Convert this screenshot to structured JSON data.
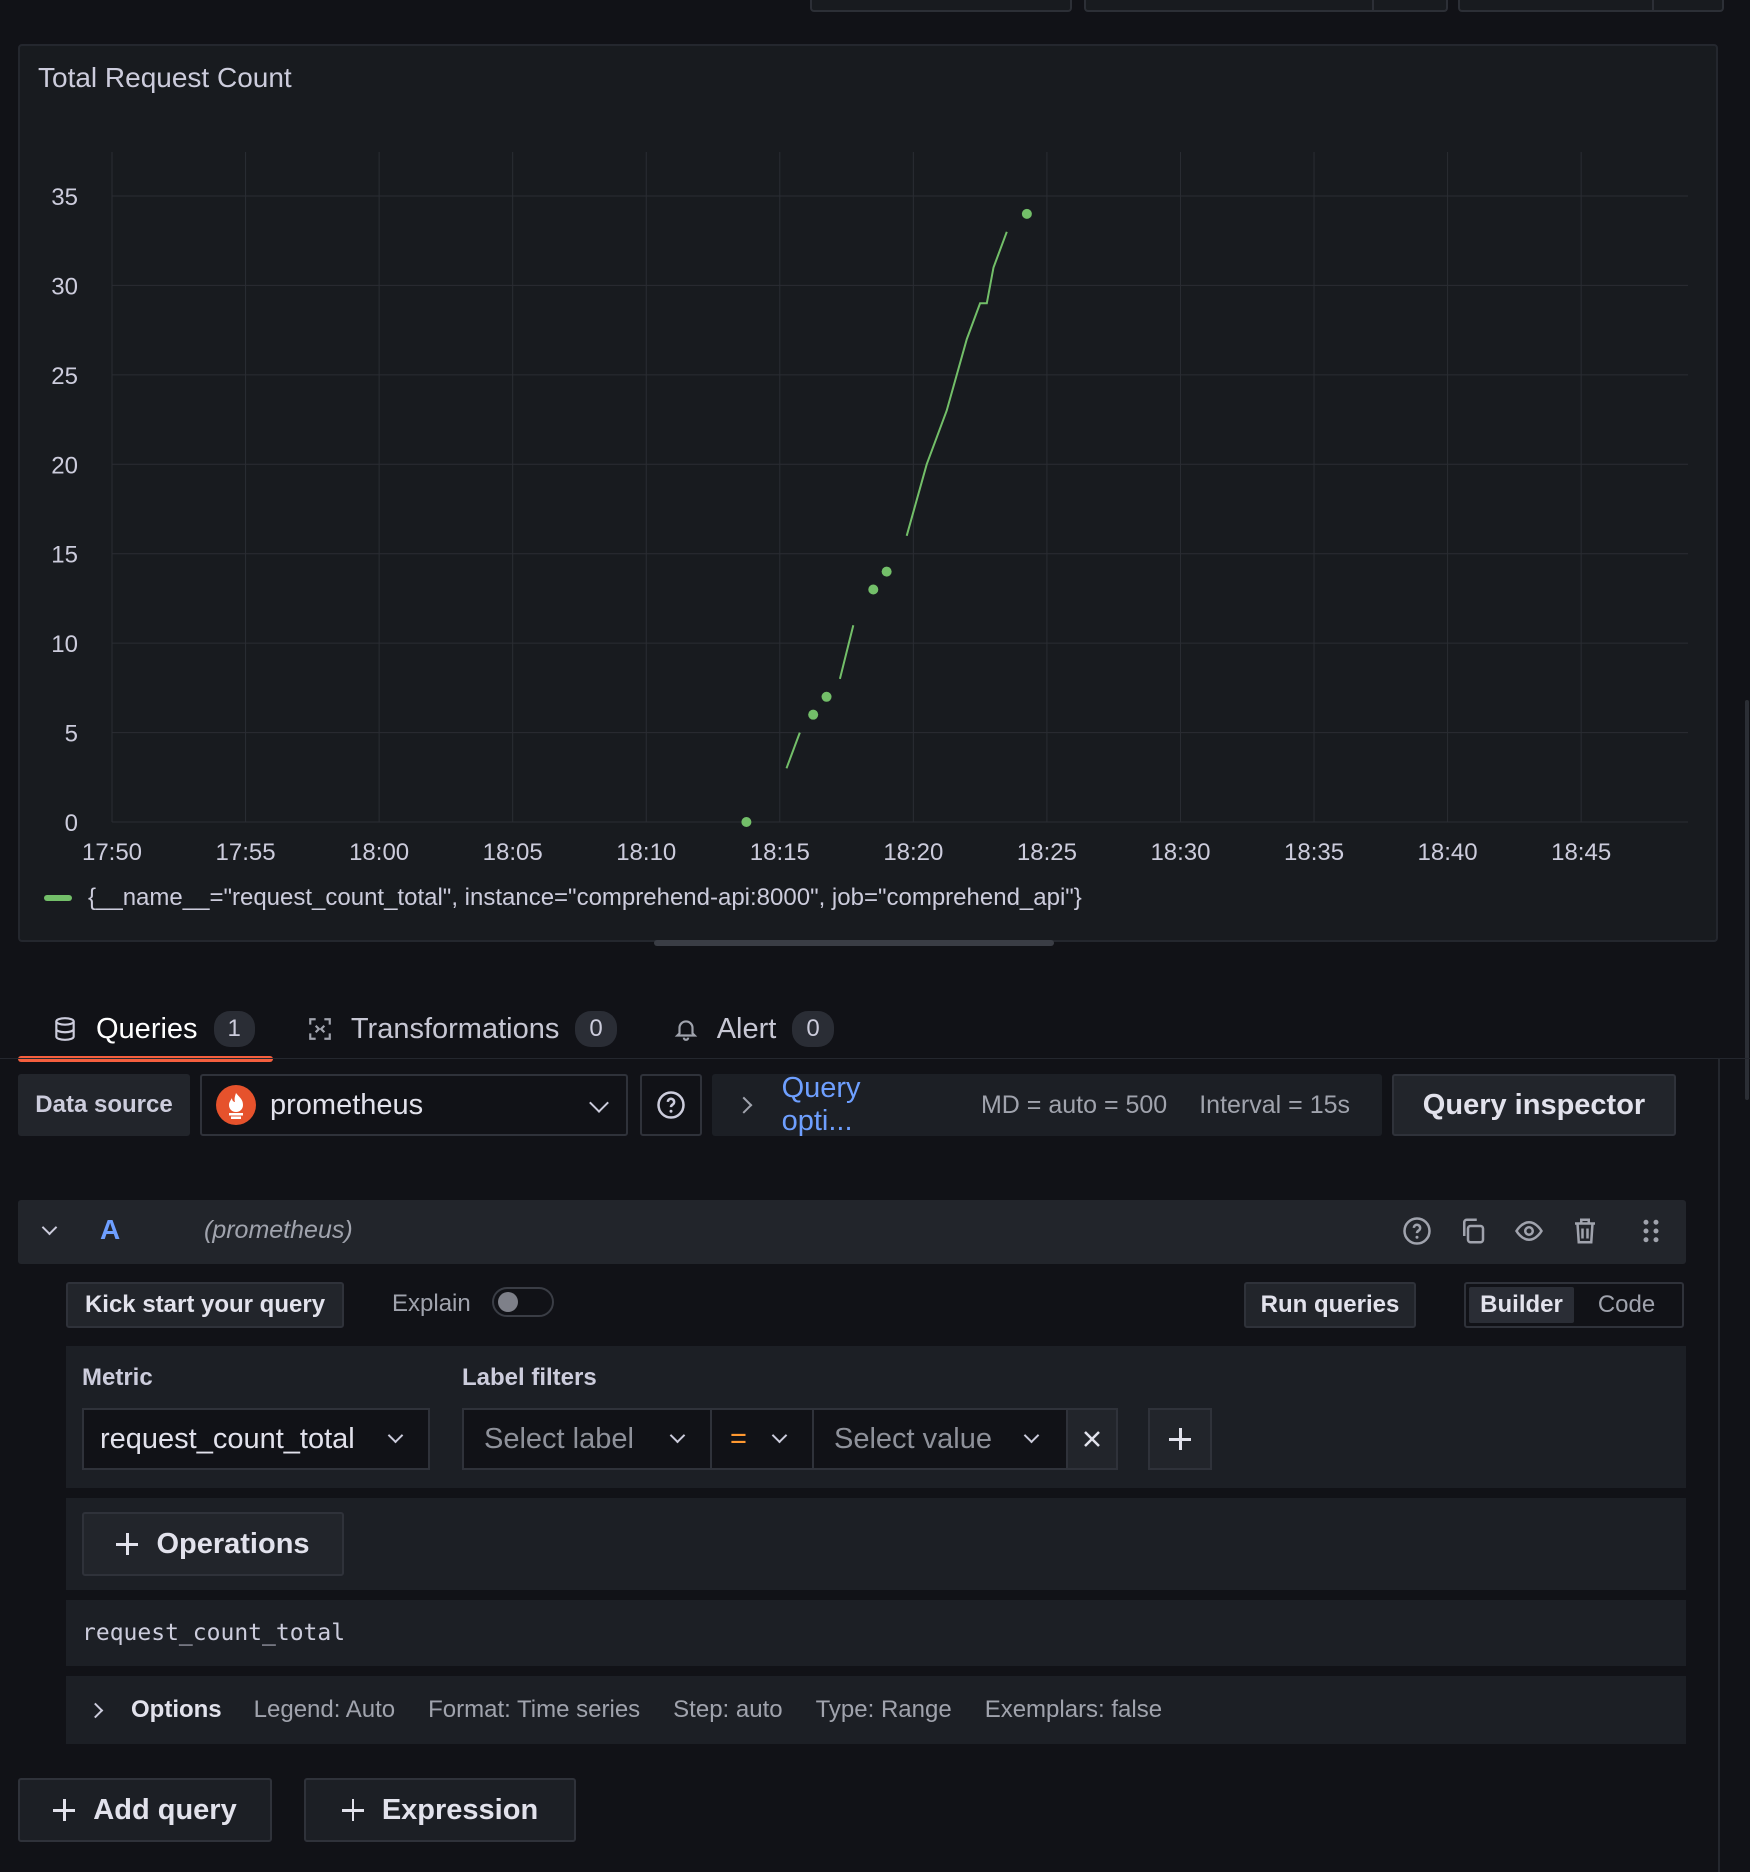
{
  "panel": {
    "title": "Total Request Count",
    "legend_label": "{__name__=\"request_count_total\", instance=\"comprehend-api:8000\", job=\"comprehend_api\"}",
    "series_color": "#73bf69"
  },
  "chart_data": {
    "type": "line",
    "title": "Total Request Count",
    "xlabel": "",
    "ylabel": "",
    "ylim": [
      0,
      35
    ],
    "xlim": [
      "17:50",
      "18:49"
    ],
    "y_ticks": [
      "0",
      "5",
      "10",
      "15",
      "20",
      "25",
      "30",
      "35"
    ],
    "x_ticks": [
      "17:50",
      "17:55",
      "18:00",
      "18:05",
      "18:10",
      "18:15",
      "18:20",
      "18:25",
      "18:30",
      "18:35",
      "18:40",
      "18:45"
    ],
    "grid": true,
    "legend_position": "bottom-left",
    "series": [
      {
        "name": "{__name__=\"request_count_total\", instance=\"comprehend-api:8000\", job=\"comprehend_api\"}",
        "color": "#73bf69",
        "segments": [
          [
            [
              "18:13:45",
              0
            ]
          ],
          [
            [
              "18:15:15",
              3
            ],
            [
              "18:15:45",
              5
            ]
          ],
          [
            [
              "18:16:15",
              6
            ]
          ],
          [
            [
              "18:16:45",
              7
            ]
          ],
          [
            [
              "18:17:15",
              8
            ],
            [
              "18:17:45",
              11
            ]
          ],
          [
            [
              "18:18:30",
              13
            ]
          ],
          [
            [
              "18:19:00",
              14
            ]
          ],
          [
            [
              "18:19:45",
              16
            ],
            [
              "18:20:30",
              20
            ],
            [
              "18:21:15",
              23
            ],
            [
              "18:22:00",
              27
            ],
            [
              "18:22:30",
              29
            ],
            [
              "18:22:45",
              29
            ],
            [
              "18:23:00",
              31
            ],
            [
              "18:23:30",
              33
            ]
          ],
          [
            [
              "18:24:15",
              34
            ]
          ]
        ]
      }
    ]
  },
  "tabs": [
    {
      "label": "Queries",
      "count": "1"
    },
    {
      "label": "Transformations",
      "count": "0"
    },
    {
      "label": "Alert",
      "count": "0"
    }
  ],
  "datasource": {
    "label": "Data source",
    "value": "prometheus",
    "query_options_link": "Query opti...",
    "md": "MD = auto = 500",
    "interval": "Interval = 15s",
    "inspector": "Query inspector"
  },
  "query": {
    "ref": "A",
    "datasource": "(prometheus)",
    "kickstart": "Kick start your query",
    "explain": "Explain",
    "run": "Run queries",
    "mode_builder": "Builder",
    "mode_code": "Code",
    "metric_label": "Metric",
    "metric_value": "request_count_total",
    "label_filters": "Label filters",
    "select_label": "Select label",
    "operator": "=",
    "select_value": "Select value",
    "operations": "Operations",
    "promql": "request_count_total",
    "options_title": "Options",
    "options": [
      "Legend: Auto",
      "Format: Time series",
      "Step: auto",
      "Type: Range",
      "Exemplars: false"
    ],
    "operator_color": "#ff9830"
  },
  "footer": {
    "add_query": "Add query",
    "expression": "Expression"
  }
}
